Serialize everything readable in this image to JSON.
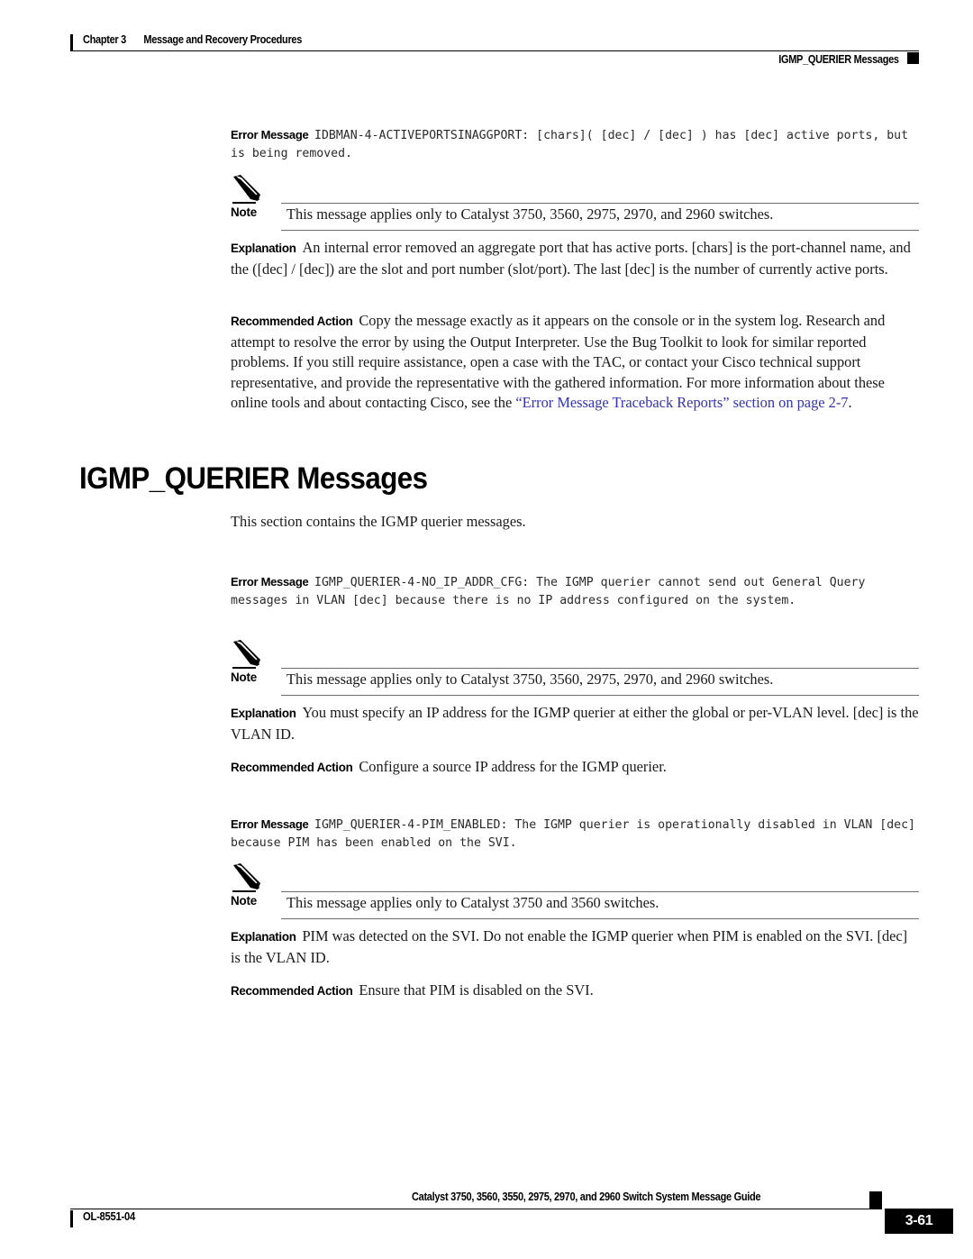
{
  "header": {
    "chapter_number": "Chapter 3",
    "chapter_title": "Message and Recovery Procedures",
    "running_head_right": "IGMP_QUERIER Messages"
  },
  "labels": {
    "error_message": "Error Message",
    "note": "Note",
    "explanation": "Explanation",
    "recommended_action": "Recommended Action"
  },
  "messages": [
    {
      "error_message_text": "IDBMAN-4-ACTIVEPORTSINAGGPORT: [chars]( [dec] / [dec] ) has [dec] active ports, but is being removed.",
      "note_text": "This message applies only to Catalyst 3750, 3560, 2975, 2970, and 2960 switches.",
      "explanation_text": "An internal error removed an aggregate port that has active ports. [chars] is the port-channel name, and the ([dec] / [dec]) are the slot and port number (slot/port). The last [dec] is the number of currently active ports.",
      "recommended_action_text_1": "Copy the message exactly as it appears on the console or in the system log. Research and attempt to resolve the error by using the Output Interpreter. Use the Bug Toolkit to look for similar reported problems. If you still require assistance, open a case with the TAC, or contact your Cisco technical support representative, and provide the representative with the gathered information. For more information about these online tools and about contacting Cisco, see the ",
      "recommended_action_link": "“Error Message Traceback Reports” section on page 2-7",
      "recommended_action_text_2": "."
    }
  ],
  "section": {
    "heading": "IGMP_QUERIER Messages",
    "intro": "This section contains the IGMP querier messages."
  },
  "section_messages": [
    {
      "error_message_text": "IGMP_QUERIER-4-NO_IP_ADDR_CFG: The IGMP querier cannot send out General Query messages in VLAN [dec] because there is no IP address configured on the system.",
      "note_text": "This message applies only to Catalyst 3750, 3560, 2975, 2970, and 2960 switches.",
      "explanation_text": "You must specify an IP address for the IGMP querier at either the global or per-VLAN level. [dec] is the VLAN ID.",
      "recommended_action_text": "Configure a source IP address for the IGMP querier."
    },
    {
      "error_message_text": "IGMP_QUERIER-4-PIM_ENABLED: The IGMP querier is operationally disabled in VLAN [dec] because PIM has been enabled on the SVI.",
      "note_text": "This message applies only to Catalyst 3750 and 3560 switches.",
      "explanation_text": "PIM was detected on the SVI. Do not enable the IGMP querier when PIM is enabled on the SVI. [dec] is the VLAN ID.",
      "recommended_action_text": "Ensure that PIM is disabled on the SVI."
    }
  ],
  "footer": {
    "doc_id": "OL-8551-04",
    "guide_title": "Catalyst 3750, 3560, 3550, 2975, 2970, and 2960 Switch System Message Guide",
    "page_number": "3-61"
  },
  "colors": {
    "link": "#3333b0",
    "text": "#1a1a1a",
    "rule": "#6d6d6d"
  }
}
